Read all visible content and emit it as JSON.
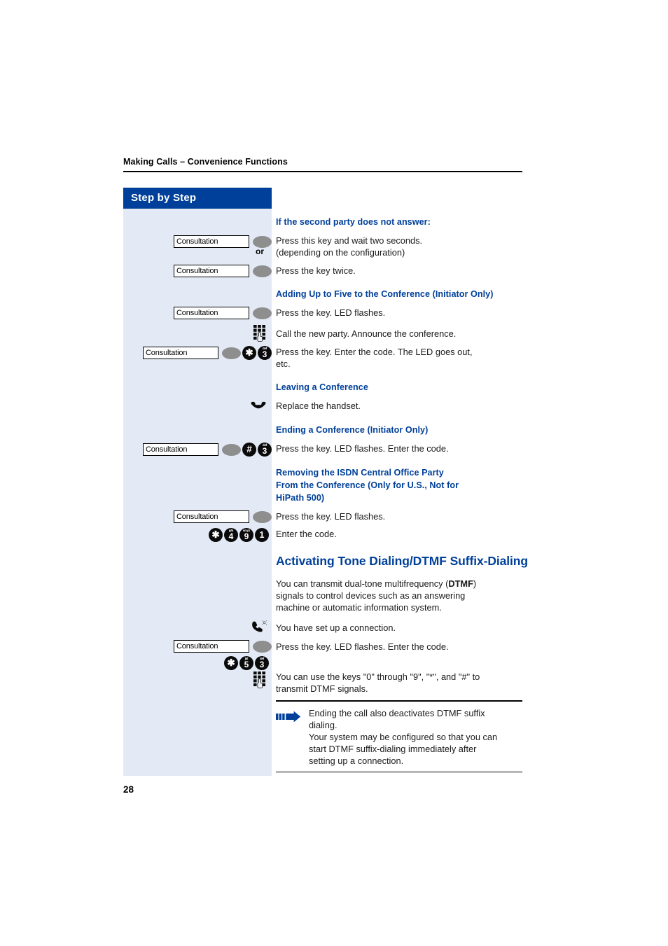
{
  "running_head": "Making Calls – Convenience Functions",
  "sidebar": {
    "title": "Step by Step"
  },
  "page_number": "28",
  "colors": {
    "accent_blue": "#00409a",
    "sidebar_bg": "#e4eaf5",
    "key_grey": "#8e8e8e",
    "text": "#1a1a1a"
  },
  "key_label": "Consultation",
  "connector_or": "or",
  "sections": [
    {
      "id": "second-party-no-answer",
      "heading": "If the second party does not answer:",
      "steps": [
        {
          "text": "Press this key and wait two seconds.\n(depending on the configuration)"
        },
        {
          "text": "Press the key twice."
        }
      ]
    },
    {
      "id": "adding-five-to-conference",
      "heading": "Adding Up to Five to the Conference (Initiator Only)",
      "steps": [
        {
          "text": "Press the key. LED flashes."
        },
        {
          "text": "Call the new party. Announce the conference."
        },
        {
          "text": "Press the key. Enter the code. The LED goes out,\netc."
        }
      ]
    },
    {
      "id": "leaving-a-conference",
      "heading": "Leaving a Conference",
      "steps": [
        {
          "text": "Replace the handset."
        }
      ]
    },
    {
      "id": "ending-a-conference",
      "heading": "Ending a Conference (Initiator Only)",
      "steps": [
        {
          "text": "Press the key. LED flashes. Enter the code."
        }
      ]
    },
    {
      "id": "removing-isdn-party",
      "heading": "Removing the ISDN Central Office Party\nFrom the Conference (Only for U.S., Not for\nHiPath 500)",
      "heading_lines": [
        "Removing the ISDN Central Office Party",
        "From the Conference (Only for U.S., Not for",
        "HiPath 500)"
      ],
      "steps": [
        {
          "text": "Press the key. LED flashes."
        },
        {
          "text": "Enter the code."
        }
      ]
    },
    {
      "id": "activating-dtmf",
      "heading": "Activating Tone Dialing/DTMF Suffix-Dialing",
      "intro_lines": [
        "You can transmit dual-tone multifrequency (",
        "DTMF",
        ")",
        "signals to control devices such as an answering",
        "machine or automatic information system."
      ],
      "steps": [
        {
          "text": "You have set up a connection."
        },
        {
          "text": "Press the key. LED flashes. Enter the code."
        },
        {
          "text": "You can use the keys \"0\" through \"9\", \"*\", and \"#\" to\ntransmit DTMF signals."
        }
      ]
    }
  ],
  "note": {
    "lines": [
      "Ending the call also deactivates DTMF suffix",
      "dialing.",
      "Your system may be configured so that you can",
      "start DTMF suffix-dialing immediately after",
      "setting up a connection."
    ]
  },
  "keys": {
    "star": {
      "glyph": "✱",
      "sub": ""
    },
    "hash": {
      "glyph": "#",
      "sub": ""
    },
    "one": {
      "num": "1",
      "sub": ""
    },
    "three": {
      "num": "3",
      "sub": "def"
    },
    "four": {
      "num": "4",
      "sub": "ghi"
    },
    "five": {
      "num": "5",
      "sub": "jkl"
    },
    "nine": {
      "num": "9",
      "sub": "wxyz"
    }
  },
  "codes": {
    "add_to_conference": "*3",
    "end_conference": "#3",
    "remove_isdn_party": "*491",
    "dtmf_suffix": "*53"
  },
  "icons": {
    "keypad": "keypad-icon",
    "handset_onhook": "handset-onhook-icon",
    "handset_connected": "handset-connected-icon",
    "note_arrow": "note-arrow-icon"
  }
}
